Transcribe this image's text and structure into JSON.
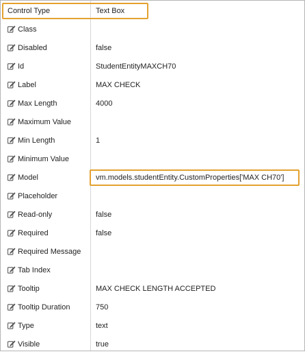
{
  "header": {
    "label": "Control Type",
    "value": "Text Box"
  },
  "properties": [
    {
      "label": "Class",
      "value": ""
    },
    {
      "label": "Disabled",
      "value": "false"
    },
    {
      "label": "Id",
      "value": "StudentEntityMAXCH70"
    },
    {
      "label": "Label",
      "value": "MAX CHECK"
    },
    {
      "label": "Max Length",
      "value": "4000"
    },
    {
      "label": "Maximum Value",
      "value": ""
    },
    {
      "label": "Min Length",
      "value": "1"
    },
    {
      "label": "Minimum Value",
      "value": ""
    },
    {
      "label": "Model",
      "value": "vm.models.studentEntity.CustomProperties['MAX CH70']"
    },
    {
      "label": "Placeholder",
      "value": ""
    },
    {
      "label": "Read-only",
      "value": "false"
    },
    {
      "label": "Required",
      "value": "false"
    },
    {
      "label": "Required Message",
      "value": ""
    },
    {
      "label": "Tab Index",
      "value": ""
    },
    {
      "label": "Tooltip",
      "value": "MAX CHECK LENGTH ACCEPTED"
    },
    {
      "label": "Tooltip Duration",
      "value": "750"
    },
    {
      "label": "Type",
      "value": "text"
    },
    {
      "label": "Visible",
      "value": "true"
    }
  ],
  "icon": "edit-icon",
  "colors": {
    "highlight": "#e3a12f",
    "border": "#b5b5b5",
    "divider": "#d6d6d6",
    "text": "#222222"
  }
}
